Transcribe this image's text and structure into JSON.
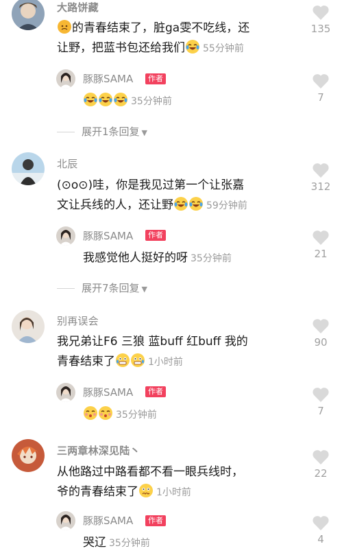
{
  "comments": [
    {
      "username": "大路饼藏",
      "text_line1": "的青春结束了，脏ga雯不吃线，还",
      "text_line2": "让野，把蓝书包还给我们",
      "time": "55分钟前",
      "likes": "135",
      "reply": {
        "username": "豚豚SAMA",
        "author_tag": "作者",
        "time": "35分钟前",
        "likes": "7"
      },
      "expand_label": "展开1条回复"
    },
    {
      "username": "北辰",
      "text_line1": "(⊙o⊙)哇，你是我见过第一个让张嘉",
      "text_line2": "文让兵线的人，还让野",
      "time": "59分钟前",
      "likes": "312",
      "reply": {
        "username": "豚豚SAMA",
        "author_tag": "作者",
        "text": "我感觉他人挺好的呀",
        "time": "35分钟前",
        "likes": "21"
      },
      "expand_label": "展开7条回复"
    },
    {
      "username": "别再误会",
      "text_line1": "我兄弟让F6 三狼 蓝buff 红buff 我的",
      "text_line2": "青春结束了",
      "time": "1小时前",
      "likes": "90",
      "reply": {
        "username": "豚豚SAMA",
        "author_tag": "作者",
        "time": "35分钟前",
        "likes": "7"
      }
    },
    {
      "username": "三两章林深见陆丶",
      "text_line1": "从他路过中路看都不看一眼兵线时，",
      "text_line2": "爷的青春结束了",
      "time": "1小时前",
      "likes": "22",
      "reply": {
        "username": "豚豚SAMA",
        "author_tag": "作者",
        "text": "哭辽",
        "time": "35分钟前",
        "likes": "4"
      }
    }
  ],
  "icons": {
    "like": "heart-icon",
    "expand": "caret-down-icon",
    "emoji_laugh": "laugh-cry-emoji-icon",
    "emoji_kiss": "kiss-emoji-icon",
    "emoji_scared": "scared-emoji-icon"
  },
  "colors": {
    "author_tag": "#f2415e",
    "name": "#8a8a8a",
    "heart": "#d9d9d9"
  }
}
